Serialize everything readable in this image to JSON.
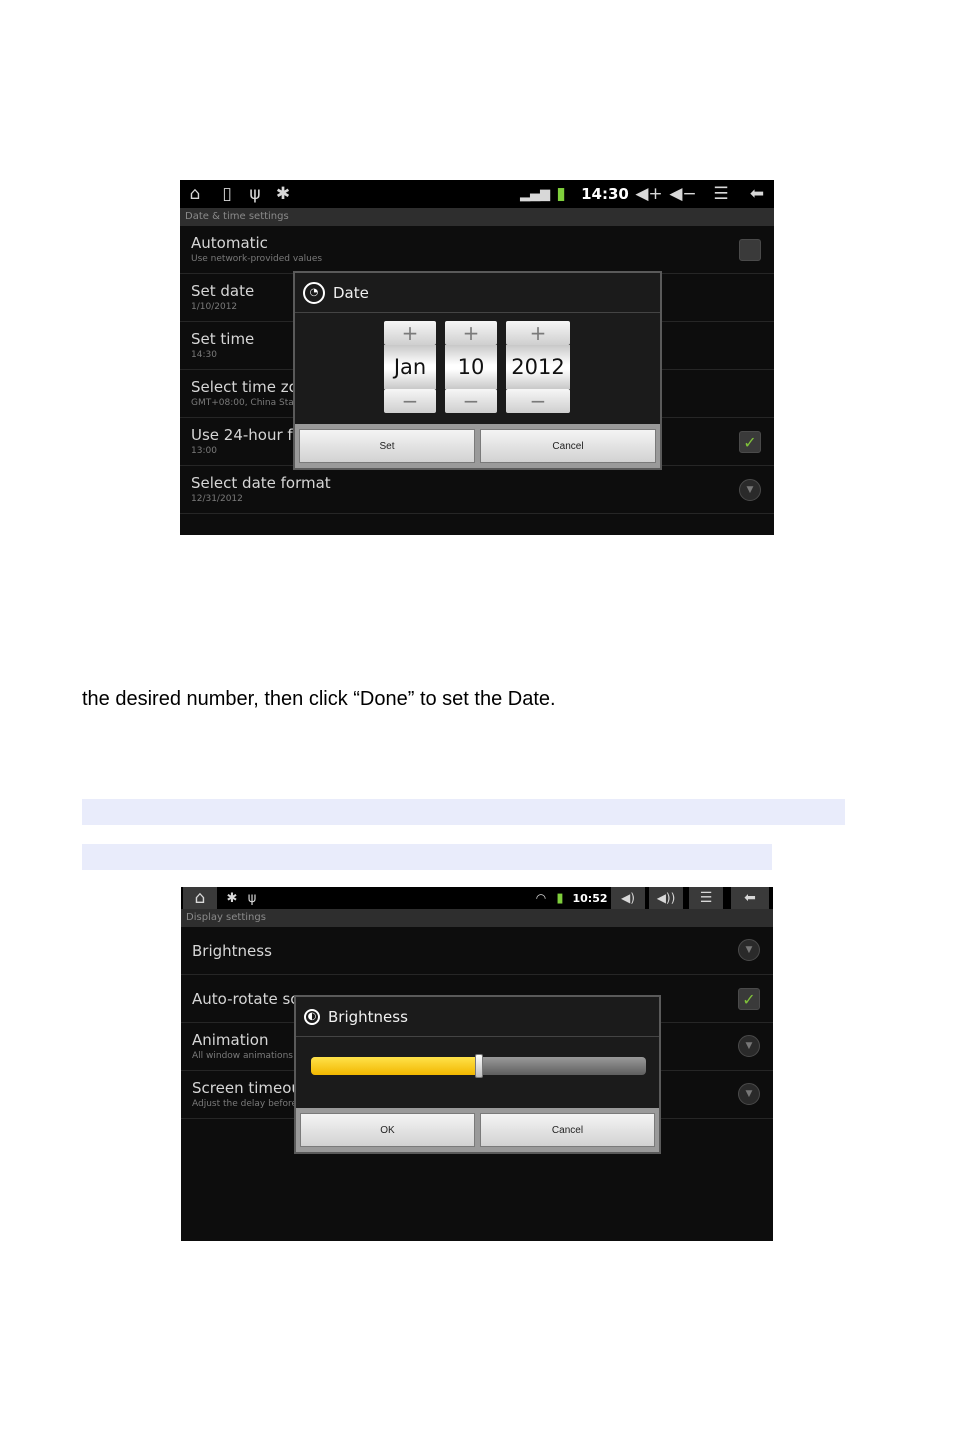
{
  "shot1": {
    "status": {
      "time": "14:30",
      "icons": [
        "home-icon",
        "sd-card-icon",
        "usb-icon",
        "android-debug-icon",
        "signal-icon",
        "battery-icon",
        "volume-up-icon",
        "volume-down-icon",
        "menu-icon",
        "back-icon"
      ]
    },
    "header": "Date & time settings",
    "rows": [
      {
        "title": "Automatic",
        "sub": "Use network-provided values"
      },
      {
        "title": "Set date",
        "sub": "1/10/2012"
      },
      {
        "title": "Set time",
        "sub": "14:30"
      },
      {
        "title": "Select time zone",
        "sub": "GMT+08:00, China Standard Time"
      },
      {
        "title": "Use 24-hour format",
        "sub": "13:00"
      },
      {
        "title": "Select date format",
        "sub": "12/31/2012"
      }
    ],
    "dialog": {
      "title": "Date",
      "month": "Jan",
      "day": "10",
      "year": "2012",
      "plus": "+",
      "minus": "−",
      "set": "Set",
      "cancel": "Cancel"
    }
  },
  "doc_text": "the desired number, then click “Done” to set the Date.",
  "shot2": {
    "status": {
      "time": "10:52",
      "icons": [
        "home-icon",
        "android-debug-icon",
        "usb-icon",
        "wifi-icon",
        "battery-icon",
        "volume-down-icon",
        "volume-up-icon",
        "menu-icon",
        "back-icon"
      ]
    },
    "header": "Display settings",
    "rows": [
      {
        "title": "Brightness",
        "sub": ""
      },
      {
        "title": "Auto-rotate screen",
        "sub": ""
      },
      {
        "title": "Animation",
        "sub": "All window animations are shown"
      },
      {
        "title": "Screen timeout",
        "sub": "Adjust the delay before the screen automatically turns off"
      }
    ],
    "dialog": {
      "title": "Brightness",
      "level": 0.5,
      "ok": "OK",
      "cancel": "Cancel"
    }
  }
}
